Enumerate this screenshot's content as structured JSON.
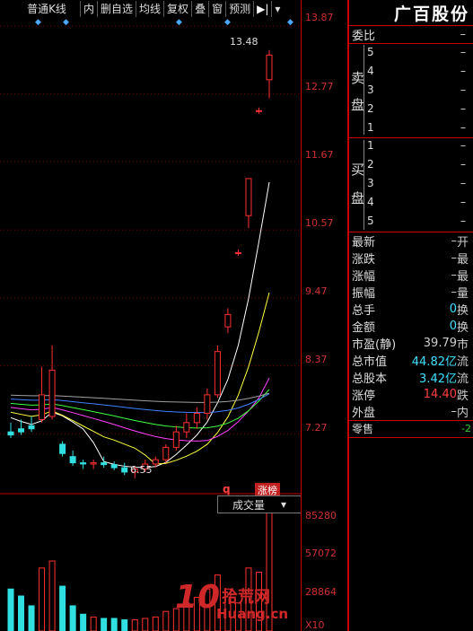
{
  "toolbar": {
    "period": "普通K线",
    "buttons": [
      "内",
      "删自选",
      "均线",
      "复权",
      "叠",
      "窗",
      "预测"
    ],
    "end_icon": "play-end-icon",
    "dropdown_icon": "dropdown-icon"
  },
  "stock": {
    "name": "广百股份"
  },
  "price_axis": [
    "13.87",
    "12.77",
    "11.67",
    "10.57",
    "9.47",
    "8.37",
    "7.27"
  ],
  "chart_annotations": {
    "high": "13.48",
    "low": "6.55",
    "mark_q": "q",
    "mark_badge": "涨榜"
  },
  "volume": {
    "header": "成交量",
    "labels": [
      "85280",
      "57072",
      "28864"
    ],
    "unit": "X10"
  },
  "order_book": {
    "title": "委比",
    "title_value": "–",
    "sell_label": [
      "卖",
      "盘"
    ],
    "buy_label": [
      "买",
      "盘"
    ],
    "sell": [
      {
        "level": "5",
        "value": "–"
      },
      {
        "level": "4",
        "value": "–"
      },
      {
        "level": "3",
        "value": "–"
      },
      {
        "level": "2",
        "value": "–"
      },
      {
        "level": "1",
        "value": "–"
      }
    ],
    "buy": [
      {
        "level": "1",
        "value": "–"
      },
      {
        "level": "2",
        "value": "–"
      },
      {
        "level": "3",
        "value": "–"
      },
      {
        "level": "4",
        "value": "–"
      },
      {
        "level": "5",
        "value": "–"
      }
    ]
  },
  "info": [
    {
      "label": "最新",
      "value": "–",
      "tail": "开",
      "color": "plain"
    },
    {
      "label": "涨跌",
      "value": "–",
      "tail": "最",
      "color": "plain"
    },
    {
      "label": "涨幅",
      "value": "–",
      "tail": "最",
      "color": "plain"
    },
    {
      "label": "振幅",
      "value": "–",
      "tail": "量",
      "color": "plain"
    },
    {
      "label": "总手",
      "value": "0",
      "tail": "换",
      "color": "cyan"
    },
    {
      "label": "金额",
      "value": "0",
      "tail": "换",
      "color": "cyan"
    },
    {
      "label": "市盈(静)",
      "value": "39.79",
      "tail": "市",
      "color": "plain"
    },
    {
      "label": "总市值",
      "value": "44.82亿",
      "tail": "流",
      "color": "cyan"
    },
    {
      "label": "总股本",
      "value": "3.42亿",
      "tail": "流",
      "color": "cyan"
    },
    {
      "label": "涨停",
      "value": "14.40",
      "tail": "跌",
      "color": "red"
    },
    {
      "label": "外盘",
      "value": "–",
      "tail": "内",
      "color": "plain"
    }
  ],
  "footer": {
    "label": "零售",
    "value": "-2"
  },
  "watermark": {
    "main": "10",
    "sub": "拾荒网",
    "url": "Huang.cn"
  },
  "chart_data": {
    "type": "candlestick",
    "ylim": [
      6.3,
      14.0
    ],
    "y_ticks": [
      13.87,
      12.77,
      11.67,
      10.57,
      9.47,
      8.37,
      7.27
    ],
    "candles": [
      {
        "o": 7.3,
        "h": 7.45,
        "l": 7.2,
        "c": 7.25
      },
      {
        "o": 7.35,
        "h": 7.5,
        "l": 7.25,
        "c": 7.3
      },
      {
        "o": 7.4,
        "h": 7.55,
        "l": 7.3,
        "c": 7.35
      },
      {
        "o": 7.5,
        "h": 8.35,
        "l": 7.45,
        "c": 7.9
      },
      {
        "o": 7.55,
        "h": 8.7,
        "l": 7.5,
        "c": 8.3
      },
      {
        "o": 7.1,
        "h": 7.15,
        "l": 6.9,
        "c": 6.95
      },
      {
        "o": 6.9,
        "h": 7.0,
        "l": 6.75,
        "c": 6.8
      },
      {
        "o": 6.8,
        "h": 6.85,
        "l": 6.7,
        "c": 6.78
      },
      {
        "o": 6.78,
        "h": 6.85,
        "l": 6.7,
        "c": 6.8
      },
      {
        "o": 6.8,
        "h": 6.9,
        "l": 6.72,
        "c": 6.77
      },
      {
        "o": 6.77,
        "h": 6.82,
        "l": 6.68,
        "c": 6.72
      },
      {
        "o": 6.72,
        "h": 6.8,
        "l": 6.6,
        "c": 6.65
      },
      {
        "o": 6.65,
        "h": 6.75,
        "l": 6.55,
        "c": 6.7
      },
      {
        "o": 6.7,
        "h": 6.85,
        "l": 6.65,
        "c": 6.78
      },
      {
        "o": 6.78,
        "h": 6.9,
        "l": 6.72,
        "c": 6.85
      },
      {
        "o": 6.85,
        "h": 7.1,
        "l": 6.8,
        "c": 7.05
      },
      {
        "o": 7.05,
        "h": 7.4,
        "l": 7.0,
        "c": 7.3
      },
      {
        "o": 7.3,
        "h": 7.6,
        "l": 7.2,
        "c": 7.45
      },
      {
        "o": 7.45,
        "h": 7.7,
        "l": 7.35,
        "c": 7.6
      },
      {
        "o": 7.6,
        "h": 8.0,
        "l": 7.5,
        "c": 7.9
      },
      {
        "o": 7.9,
        "h": 8.7,
        "l": 7.85,
        "c": 8.6
      },
      {
        "o": 9.0,
        "h": 9.3,
        "l": 8.9,
        "c": 9.2
      },
      {
        "o": 10.2,
        "h": 10.25,
        "l": 10.15,
        "c": 10.2
      },
      {
        "o": 10.8,
        "h": 11.4,
        "l": 10.6,
        "c": 11.4
      },
      {
        "o": 12.5,
        "h": 12.55,
        "l": 12.45,
        "c": 12.5
      },
      {
        "o": 13.0,
        "h": 13.48,
        "l": 12.7,
        "c": 13.4
      }
    ],
    "volume": [
      30000,
      25000,
      18000,
      45000,
      50000,
      32000,
      18000,
      12000,
      10000,
      9000,
      9000,
      8000,
      8000,
      9000,
      10000,
      14000,
      16000,
      20000,
      24000,
      30000,
      40000,
      30000,
      20000,
      45000,
      42000,
      85280
    ]
  }
}
